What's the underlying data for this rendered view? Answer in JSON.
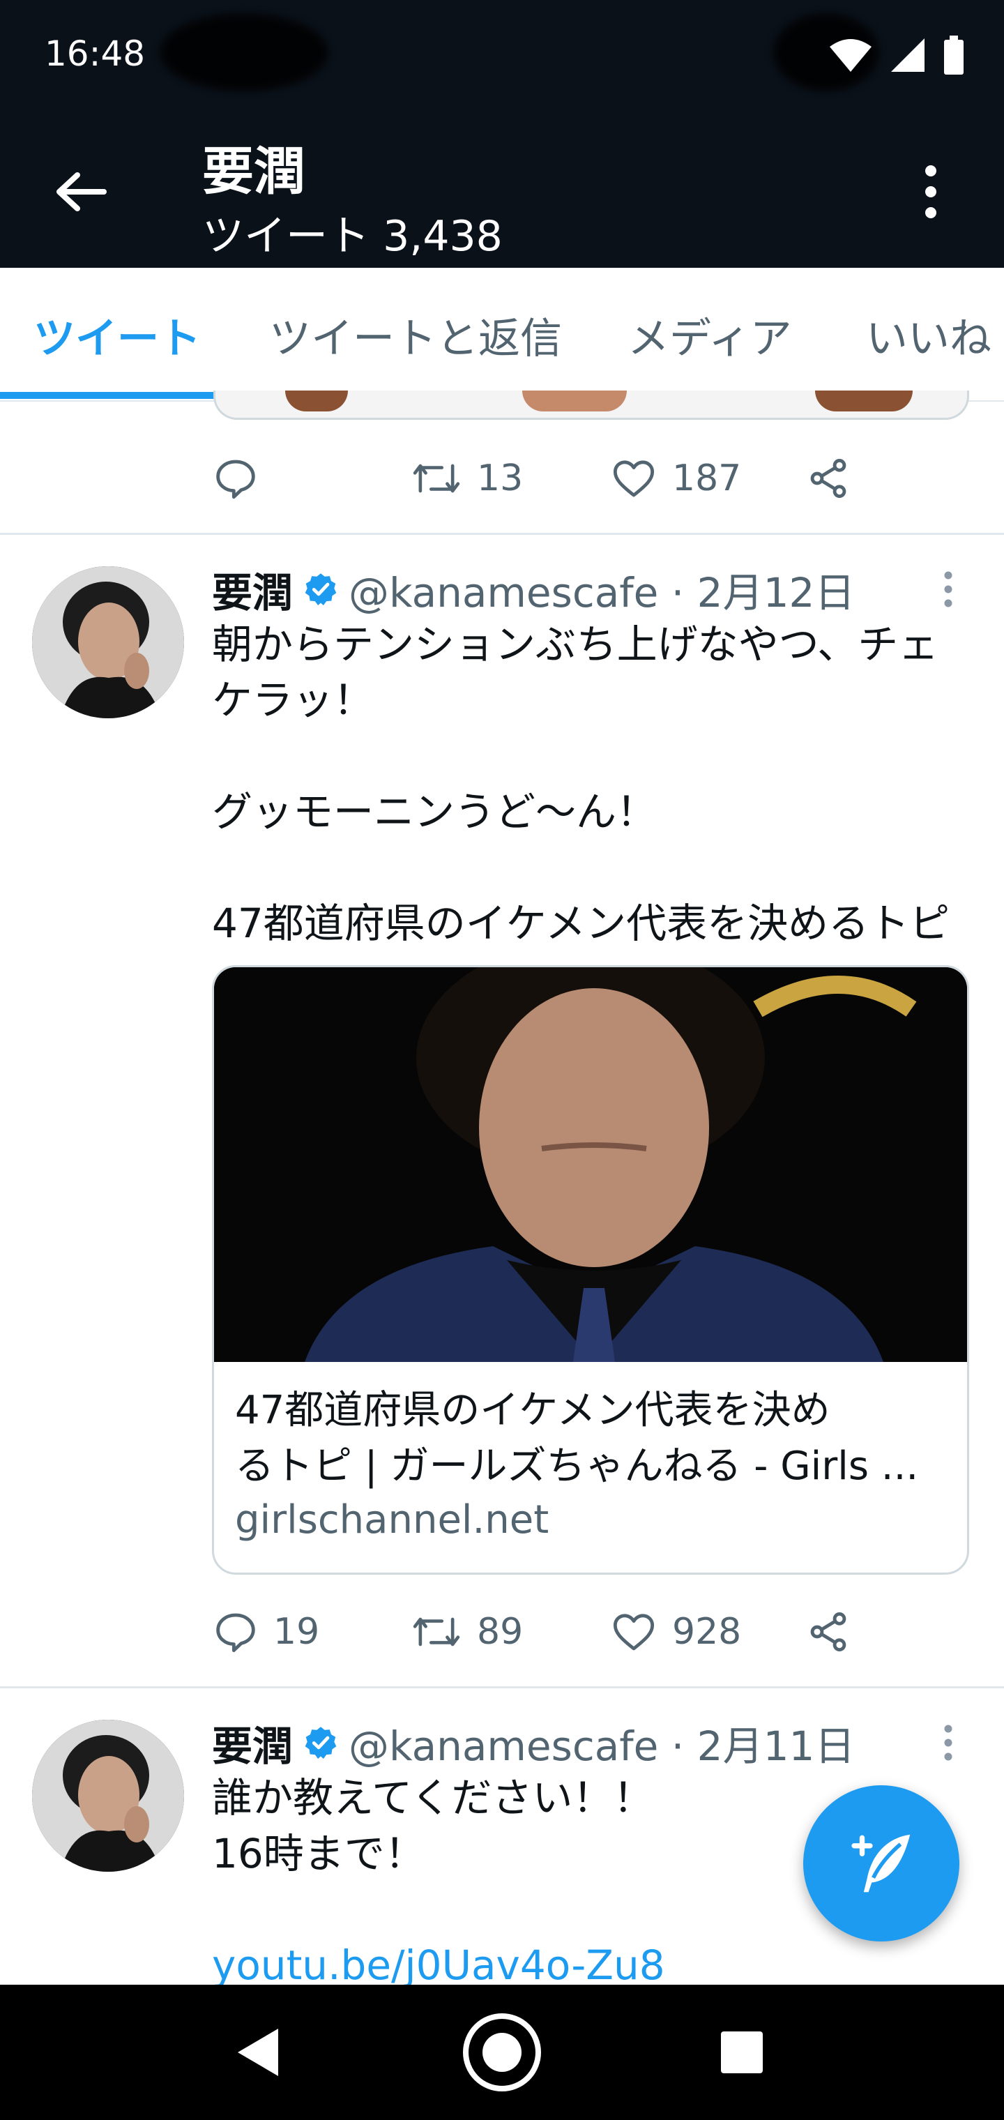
{
  "status_bar": {
    "time": "16:48"
  },
  "header": {
    "title": "要潤",
    "subtitle": "ツイート 3,438"
  },
  "tabs": [
    {
      "label": "ツイート",
      "active": true
    },
    {
      "label": "ツイートと返信",
      "active": false
    },
    {
      "label": "メディア",
      "active": false
    },
    {
      "label": "いいね",
      "active": false
    }
  ],
  "tweet0": {
    "retweets": "13",
    "likes": "187"
  },
  "tweet1": {
    "name": "要潤",
    "handle": "@kanamescafe · 2月12日",
    "lines": [
      "朝からテンションぶち上げなやつ、チェ",
      "ケラッ！",
      "",
      "グッモーニンうど〜ん！",
      "",
      "47都道府県のイケメン代表を決めるトピ"
    ],
    "card": {
      "title_line1": "47都道府県のイケメン代表を決め",
      "title_line2": "るトピ | ガールズちゃんねる - Girls ...",
      "domain": "girlschannel.net"
    },
    "replies": "19",
    "retweets": "89",
    "likes": "928"
  },
  "tweet2": {
    "name": "要潤",
    "handle": "@kanamescafe · 2月11日",
    "lines": [
      "誰か教えてください！！",
      "16時まで！",
      ""
    ],
    "link": "youtu.be/j0Uav4o-Zu8"
  },
  "colors": {
    "accent": "#1d9bf0",
    "header_bg": "#0a1119",
    "muted": "#536471"
  },
  "icons": [
    "back-arrow-icon",
    "more-vertical-icon",
    "reply-icon",
    "retweet-icon",
    "like-icon",
    "share-icon",
    "verified-badge-icon",
    "compose-tweet-icon",
    "nav-back-icon",
    "nav-home-icon",
    "nav-recents-icon"
  ]
}
